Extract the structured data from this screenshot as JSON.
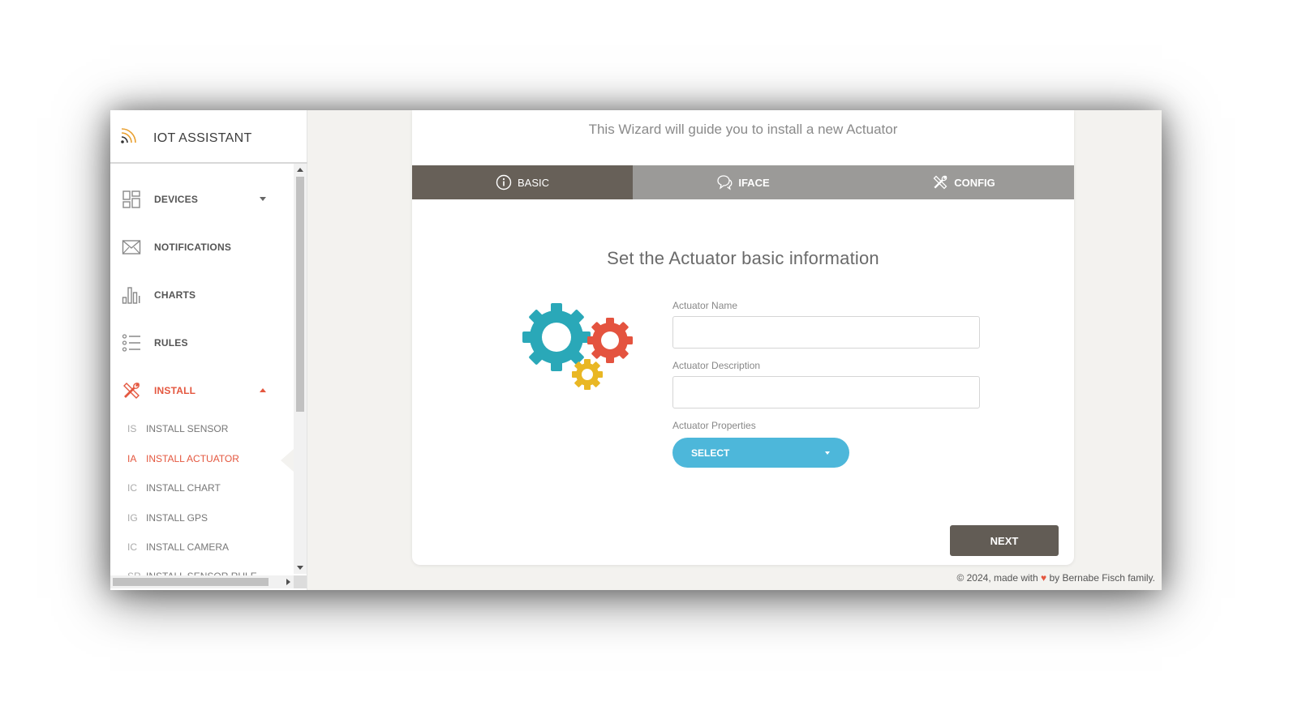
{
  "app": {
    "title": "IOT ASSISTANT"
  },
  "sidebar": {
    "items": [
      {
        "label": "DEVICES",
        "icon": "dashboard-icon",
        "caret": "down"
      },
      {
        "label": "NOTIFICATIONS",
        "icon": "envelope-icon"
      },
      {
        "label": "CHARTS",
        "icon": "bar-chart-icon"
      },
      {
        "label": "RULES",
        "icon": "list-icon"
      },
      {
        "label": "INSTALL",
        "icon": "tools-icon",
        "caret": "up",
        "active": true
      }
    ],
    "subitems": [
      {
        "abbr": "IS",
        "label": "INSTALL SENSOR"
      },
      {
        "abbr": "IA",
        "label": "INSTALL ACTUATOR",
        "active": true
      },
      {
        "abbr": "IC",
        "label": "INSTALL CHART"
      },
      {
        "abbr": "IG",
        "label": "INSTALL GPS"
      },
      {
        "abbr": "IC",
        "label": "INSTALL CAMERA"
      },
      {
        "abbr": "SR",
        "label": "INSTALL SENSOR RULE"
      }
    ]
  },
  "wizard": {
    "intro": "This Wizard will guide you to install a new Actuator",
    "tabs": [
      {
        "label": "BASIC",
        "icon": "info-icon",
        "active": true
      },
      {
        "label": "IFACE",
        "icon": "chat-icon"
      },
      {
        "label": "CONFIG",
        "icon": "tools-icon"
      }
    ],
    "section_title": "Set the Actuator basic information",
    "fields": {
      "name_label": "Actuator Name",
      "name_value": "",
      "description_label": "Actuator Description",
      "description_value": "",
      "properties_label": "Actuator Properties",
      "select_label": "SELECT"
    },
    "next_label": "NEXT"
  },
  "footer": {
    "prefix": "© 2024, made with",
    "heart": "♥",
    "suffix": "by Bernabe Fisch family."
  },
  "colors": {
    "accent": "#e4573f",
    "tab_active": "#676058",
    "tab_inactive": "#9b9a98",
    "select": "#4db7da",
    "gear_teal": "#2aa8b8",
    "gear_red": "#e4533f",
    "gear_yellow": "#e9b724"
  }
}
